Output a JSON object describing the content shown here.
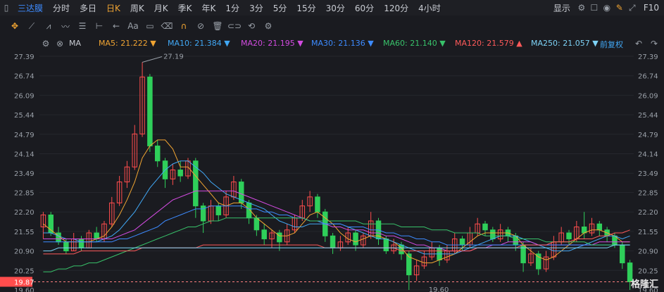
{
  "header": {
    "stock_name": "三达膜",
    "periods": [
      "分时",
      "多日",
      "日K",
      "周K",
      "月K",
      "季K",
      "年K",
      "1分",
      "3分",
      "5分",
      "15分",
      "30分",
      "60分",
      "120分",
      "4小时"
    ],
    "active_period": "日K",
    "display_label": "显示",
    "f10_label": "F10"
  },
  "ma_bar": {
    "ma_label": "MA",
    "items": [
      {
        "label": "MA5: 21.222",
        "color": "#f0a432",
        "arrow": "▼"
      },
      {
        "label": "MA10: 21.384",
        "color": "#41a8f5",
        "arrow": "▼"
      },
      {
        "label": "MA20: 21.195",
        "color": "#d24be0",
        "arrow": "▼"
      },
      {
        "label": "MA30: 21.136",
        "color": "#3d8bff",
        "arrow": "▼"
      },
      {
        "label": "MA60: 21.140",
        "color": "#38c26a",
        "arrow": "▼"
      },
      {
        "label": "MA120: 21.579",
        "color": "#ff5a5a",
        "arrow": "▲"
      },
      {
        "label": "MA250: 21.057",
        "color": "#7ed3f7",
        "arrow": "▼"
      }
    ],
    "adjust_label": "前复权"
  },
  "colors": {
    "up": "#ff4d4d",
    "down": "#2fcf5a",
    "background": "#1a1b20"
  },
  "chart_data": {
    "type": "candlestick",
    "y_ticks": [
      "27.39",
      "26.74",
      "26.09",
      "25.44",
      "24.79",
      "24.14",
      "23.49",
      "22.85",
      "22.20",
      "21.55",
      "20.90",
      "20.25",
      "19.60"
    ],
    "ylim": [
      19.6,
      27.39
    ],
    "current_price_label": "19.87",
    "max_label": "27.19",
    "min_label": "19.60",
    "candles": [
      [
        21.7,
        22.1,
        21.3,
        22.2
      ],
      [
        22.1,
        21.5,
        21.4,
        22.2
      ],
      [
        21.5,
        21.2,
        21.1,
        21.7
      ],
      [
        21.2,
        20.9,
        20.8,
        21.3
      ],
      [
        20.9,
        21.3,
        20.9,
        21.5
      ],
      [
        21.3,
        21.0,
        20.9,
        21.4
      ],
      [
        21.0,
        21.5,
        21.0,
        21.6
      ],
      [
        21.5,
        21.3,
        21.2,
        21.7
      ],
      [
        21.3,
        21.8,
        21.2,
        21.9
      ],
      [
        21.8,
        22.5,
        21.7,
        22.7
      ],
      [
        22.5,
        23.2,
        22.4,
        23.4
      ],
      [
        23.2,
        23.7,
        23.0,
        23.9
      ],
      [
        23.7,
        24.8,
        23.6,
        25.1
      ],
      [
        24.8,
        26.7,
        24.7,
        27.19
      ],
      [
        26.7,
        24.4,
        24.2,
        26.8
      ],
      [
        24.4,
        23.9,
        23.7,
        24.6
      ],
      [
        23.9,
        23.3,
        23.0,
        24.0
      ],
      [
        23.3,
        23.6,
        23.1,
        23.8
      ],
      [
        23.6,
        23.4,
        23.2,
        23.9
      ],
      [
        23.4,
        23.9,
        23.3,
        24.0
      ],
      [
        23.9,
        22.4,
        22.0,
        24.0
      ],
      [
        22.4,
        21.9,
        21.5,
        22.5
      ],
      [
        21.9,
        22.4,
        21.8,
        22.6
      ],
      [
        22.4,
        22.1,
        21.9,
        22.5
      ],
      [
        22.1,
        22.7,
        22.0,
        22.9
      ],
      [
        22.7,
        23.2,
        22.6,
        23.4
      ],
      [
        23.2,
        22.5,
        22.3,
        23.3
      ],
      [
        22.5,
        22.0,
        21.8,
        22.6
      ],
      [
        22.0,
        21.6,
        21.4,
        22.1
      ],
      [
        21.6,
        21.3,
        21.1,
        21.8
      ],
      [
        21.3,
        21.5,
        21.0,
        21.6
      ],
      [
        21.5,
        21.2,
        20.9,
        21.6
      ],
      [
        21.2,
        21.6,
        21.1,
        21.8
      ],
      [
        21.6,
        22.0,
        21.5,
        22.1
      ],
      [
        22.0,
        22.4,
        21.9,
        22.6
      ],
      [
        22.4,
        22.7,
        22.2,
        22.9
      ],
      [
        22.7,
        22.2,
        22.0,
        22.8
      ],
      [
        22.2,
        21.4,
        21.2,
        22.3
      ],
      [
        21.4,
        21.0,
        20.8,
        21.5
      ],
      [
        21.0,
        21.2,
        20.9,
        21.4
      ],
      [
        21.2,
        21.5,
        21.1,
        21.7
      ],
      [
        21.5,
        21.1,
        20.9,
        21.6
      ],
      [
        21.1,
        21.4,
        21.0,
        21.5
      ],
      [
        21.4,
        21.9,
        21.3,
        22.2
      ],
      [
        21.9,
        21.3,
        21.1,
        22.0
      ],
      [
        21.3,
        20.9,
        20.8,
        21.4
      ],
      [
        20.9,
        21.1,
        20.8,
        21.3
      ],
      [
        21.1,
        20.8,
        20.6,
        21.2
      ],
      [
        20.8,
        20.1,
        19.6,
        20.9
      ],
      [
        20.1,
        20.4,
        19.9,
        20.6
      ],
      [
        20.4,
        20.7,
        20.3,
        20.9
      ],
      [
        20.7,
        21.0,
        20.6,
        21.2
      ],
      [
        21.0,
        20.6,
        20.4,
        21.1
      ],
      [
        20.6,
        20.9,
        20.5,
        21.1
      ],
      [
        20.9,
        21.3,
        20.8,
        21.5
      ],
      [
        21.3,
        21.1,
        20.9,
        21.4
      ],
      [
        21.1,
        21.5,
        21.0,
        21.7
      ],
      [
        21.5,
        21.8,
        21.4,
        22.0
      ],
      [
        21.8,
        21.6,
        21.4,
        21.9
      ],
      [
        21.6,
        21.3,
        21.2,
        21.7
      ],
      [
        21.3,
        21.6,
        21.2,
        21.8
      ],
      [
        21.6,
        21.4,
        21.2,
        21.7
      ],
      [
        21.4,
        21.1,
        20.9,
        21.5
      ],
      [
        21.1,
        20.5,
        20.2,
        21.2
      ],
      [
        20.5,
        20.8,
        20.4,
        21.0
      ],
      [
        20.8,
        20.3,
        20.1,
        20.9
      ],
      [
        20.3,
        20.7,
        20.2,
        20.9
      ],
      [
        20.7,
        21.2,
        20.6,
        21.4
      ],
      [
        21.2,
        21.5,
        21.1,
        21.7
      ],
      [
        21.5,
        21.3,
        21.1,
        21.6
      ],
      [
        21.3,
        21.7,
        21.2,
        21.9
      ],
      [
        21.7,
        21.5,
        21.3,
        22.2
      ],
      [
        21.5,
        21.8,
        21.4,
        22.0
      ],
      [
        21.8,
        21.6,
        21.4,
        21.9
      ],
      [
        21.6,
        21.4,
        21.2,
        21.7
      ],
      [
        21.4,
        21.1,
        21.0,
        21.5
      ],
      [
        21.1,
        20.5,
        20.3,
        21.2
      ],
      [
        20.5,
        19.87,
        19.6,
        20.6
      ]
    ],
    "ma_lines": [
      {
        "name": "MA5",
        "color": "#f0a432",
        "values": [
          21.8,
          21.6,
          21.4,
          21.2,
          21.2,
          21.2,
          21.2,
          21.3,
          21.4,
          21.7,
          22.1,
          22.6,
          23.2,
          24.0,
          24.4,
          24.6,
          24.6,
          24.3,
          23.7,
          23.7,
          23.4,
          23.1,
          22.8,
          22.5,
          22.4,
          22.5,
          22.5,
          22.3,
          22.0,
          21.8,
          21.6,
          21.4,
          21.4,
          21.5,
          21.8,
          22.1,
          22.2,
          22.0,
          21.8,
          21.5,
          21.3,
          21.2,
          21.3,
          21.4,
          21.4,
          21.3,
          21.2,
          21.0,
          20.7,
          20.6,
          20.5,
          20.5,
          20.6,
          20.7,
          20.8,
          21.0,
          21.2,
          21.4,
          21.5,
          21.5,
          21.5,
          21.5,
          21.4,
          21.1,
          20.9,
          20.7,
          20.6,
          20.7,
          20.9,
          21.1,
          21.3,
          21.5,
          21.6,
          21.6,
          21.5,
          21.4,
          21.2,
          21.2
        ]
      },
      {
        "name": "MA10",
        "color": "#41a8f5",
        "values": [
          21.5,
          21.5,
          21.4,
          21.3,
          21.3,
          21.2,
          21.2,
          21.2,
          21.3,
          21.4,
          21.6,
          21.9,
          22.2,
          22.6,
          23.0,
          23.3,
          23.6,
          23.8,
          23.9,
          23.9,
          23.7,
          23.5,
          23.2,
          23.0,
          22.8,
          22.7,
          22.6,
          22.5,
          22.4,
          22.3,
          22.1,
          21.9,
          21.8,
          21.7,
          21.7,
          21.8,
          21.8,
          21.8,
          21.8,
          21.8,
          21.7,
          21.6,
          21.5,
          21.4,
          21.3,
          21.3,
          21.2,
          21.1,
          21.0,
          20.9,
          20.8,
          20.8,
          20.8,
          20.8,
          20.8,
          20.9,
          21.0,
          21.1,
          21.2,
          21.3,
          21.4,
          21.4,
          21.4,
          21.3,
          21.2,
          21.1,
          21.0,
          20.9,
          20.9,
          20.9,
          21.0,
          21.1,
          21.2,
          21.3,
          21.4,
          21.4,
          21.3,
          21.4
        ]
      },
      {
        "name": "MA20",
        "color": "#d24be0",
        "values": [
          21.3,
          21.3,
          21.3,
          21.3,
          21.3,
          21.3,
          21.3,
          21.3,
          21.3,
          21.3,
          21.4,
          21.5,
          21.6,
          21.8,
          22.0,
          22.2,
          22.4,
          22.6,
          22.7,
          22.8,
          22.9,
          22.9,
          22.9,
          22.9,
          22.9,
          22.9,
          22.8,
          22.7,
          22.6,
          22.5,
          22.4,
          22.3,
          22.2,
          22.1,
          22.0,
          21.9,
          21.9,
          21.8,
          21.7,
          21.7,
          21.6,
          21.6,
          21.6,
          21.5,
          21.5,
          21.4,
          21.4,
          21.3,
          21.2,
          21.1,
          21.1,
          21.0,
          21.0,
          20.9,
          20.9,
          20.9,
          20.9,
          21.0,
          21.0,
          21.1,
          21.1,
          21.2,
          21.2,
          21.2,
          21.2,
          21.1,
          21.1,
          21.1,
          21.1,
          21.1,
          21.1,
          21.1,
          21.1,
          21.2,
          21.2,
          21.2,
          21.2,
          21.2
        ]
      },
      {
        "name": "MA30",
        "color": "#3d8bff",
        "values": [
          21.2,
          21.2,
          21.2,
          21.2,
          21.2,
          21.2,
          21.2,
          21.2,
          21.2,
          21.2,
          21.3,
          21.3,
          21.4,
          21.5,
          21.6,
          21.7,
          21.9,
          22.0,
          22.1,
          22.2,
          22.3,
          22.3,
          22.4,
          22.4,
          22.4,
          22.4,
          22.4,
          22.3,
          22.3,
          22.2,
          22.2,
          22.1,
          22.1,
          22.0,
          22.0,
          21.9,
          21.9,
          21.8,
          21.8,
          21.8,
          21.7,
          21.7,
          21.7,
          21.6,
          21.6,
          21.5,
          21.5,
          21.4,
          21.4,
          21.3,
          21.3,
          21.2,
          21.2,
          21.1,
          21.1,
          21.1,
          21.1,
          21.1,
          21.1,
          21.1,
          21.1,
          21.1,
          21.1,
          21.1,
          21.1,
          21.1,
          21.1,
          21.1,
          21.1,
          21.1,
          21.1,
          21.1,
          21.1,
          21.1,
          21.1,
          21.1,
          21.1,
          21.1
        ]
      },
      {
        "name": "MA60",
        "color": "#38c26a",
        "values": [
          20.2,
          20.2,
          20.3,
          20.3,
          20.4,
          20.4,
          20.5,
          20.5,
          20.6,
          20.7,
          20.8,
          20.9,
          21.0,
          21.1,
          21.2,
          21.3,
          21.4,
          21.5,
          21.6,
          21.7,
          21.7,
          21.8,
          21.9,
          21.9,
          22.0,
          22.0,
          22.0,
          22.0,
          22.0,
          22.0,
          22.0,
          22.0,
          22.0,
          22.0,
          22.0,
          21.9,
          21.9,
          21.9,
          21.9,
          21.9,
          21.9,
          21.9,
          21.8,
          21.8,
          21.8,
          21.8,
          21.8,
          21.7,
          21.7,
          21.7,
          21.7,
          21.6,
          21.6,
          21.6,
          21.5,
          21.5,
          21.5,
          21.5,
          21.4,
          21.4,
          21.4,
          21.4,
          21.3,
          21.3,
          21.3,
          21.3,
          21.2,
          21.2,
          21.2,
          21.2,
          21.2,
          21.2,
          21.1,
          21.1,
          21.1,
          21.1,
          21.1,
          21.1
        ]
      },
      {
        "name": "MA120",
        "color": "#ff5a5a",
        "values": [
          20.8,
          20.8,
          20.8,
          20.8,
          20.8,
          20.9,
          20.9,
          20.9,
          20.9,
          20.9,
          20.9,
          20.9,
          20.9,
          21.0,
          21.0,
          21.0,
          21.0,
          21.0,
          21.0,
          21.0,
          21.0,
          21.1,
          21.1,
          21.1,
          21.1,
          21.1,
          21.1,
          21.1,
          21.1,
          21.1,
          21.1,
          21.1,
          21.1,
          21.1,
          21.1,
          21.1,
          21.1,
          21.0,
          21.0,
          21.0,
          21.0,
          21.0,
          21.0,
          21.0,
          21.0,
          21.0,
          21.0,
          20.9,
          20.9,
          20.9,
          20.9,
          20.9,
          20.9,
          20.9,
          20.9,
          20.9,
          20.9,
          21.0,
          21.0,
          21.0,
          21.0,
          21.0,
          21.0,
          21.1,
          21.1,
          21.1,
          21.1,
          21.2,
          21.2,
          21.2,
          21.3,
          21.3,
          21.3,
          21.4,
          21.4,
          21.5,
          21.5,
          21.6
        ]
      },
      {
        "name": "MA250",
        "color": "#7ed3f7",
        "values": [
          20.9,
          20.9,
          21.0,
          21.0,
          21.0,
          21.0,
          21.0,
          21.0,
          21.0,
          21.0,
          21.0,
          21.0,
          21.0,
          21.0,
          21.0,
          21.0,
          21.0,
          21.0,
          21.0,
          21.0,
          21.0,
          21.0,
          21.0,
          21.0,
          21.0,
          21.0,
          21.0,
          21.0,
          21.0,
          21.0,
          21.0,
          21.0,
          21.0,
          21.0,
          21.0,
          21.0,
          21.0,
          21.0,
          21.0,
          21.0,
          21.0,
          21.0,
          21.0,
          21.0,
          21.0,
          21.0,
          21.0,
          21.0,
          21.0,
          21.0,
          21.0,
          21.0,
          21.0,
          21.0,
          21.0,
          21.0,
          21.0,
          21.0,
          21.0,
          21.0,
          21.0,
          21.0,
          21.0,
          21.0,
          21.0,
          21.0,
          21.0,
          21.0,
          21.0,
          21.0,
          21.0,
          21.0,
          21.0,
          21.0,
          21.0,
          21.1,
          21.1,
          21.1
        ]
      }
    ]
  },
  "watermark": "格隆汇"
}
